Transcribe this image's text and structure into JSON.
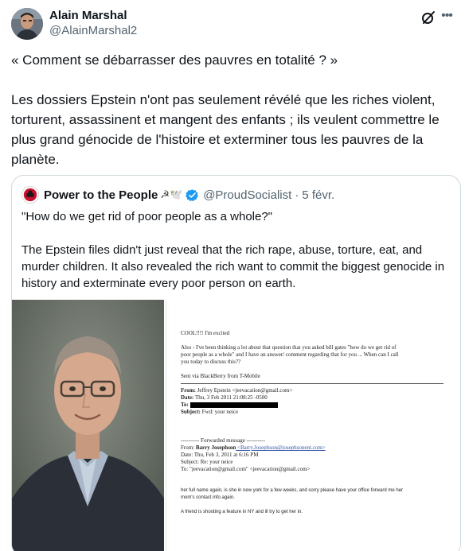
{
  "author": {
    "display_name": "Alain Marshal",
    "handle": "@AlainMarshal2"
  },
  "tweet": {
    "paragraphs": [
      "« Comment se débarrasser des pauvres en totalité ? »",
      "Les dossiers Epstein n'ont pas seulement révélé que les riches violent, torturent, assassinent et mangent des enfants ; ils veulent commettre le plus grand génocide de l'histoire et exterminer tous les pauvres de la planète."
    ]
  },
  "quote": {
    "display_name": "Power to the People",
    "name_emoji": "☭🕊️",
    "handle": "@ProudSocialist",
    "separator": "·",
    "date": "5 févr.",
    "paragraphs": [
      "\"How do we get rid of poor people as a whole?\"",
      "The Epstein files didn't just reveal that the rich rape, abuse, torture, eat, and murder children. It also revealed the rich want to commit the biggest genocide in history and exterminate every poor person on earth."
    ]
  },
  "document": {
    "line1": "COOL!!!! I'm excited",
    "line2": "Also - I've been thinking a lot about that question that you asked bill gates \"how do we get rid of",
    "line3": "poor people as a whole\" and I have an answer/ comment regarding that for you ... When can I call",
    "line4": "you today to discuss this??",
    "line5": "Sent via BlackBerry from T-Mobile",
    "from_label": "From:",
    "from_value": " Jeffrey Epstein <jeevacation@gmail.com>",
    "date_label": "Date:",
    "date_value": " Thu, 3 Feb 2011 21:08:25 -0500",
    "to_label": "To:",
    "subject_label": "Subject:",
    "subject_value": " Fwd: your neice",
    "fwd_header": "---------- Forwarded message ----------",
    "fwd_from_label": "From: ",
    "fwd_from_name": "Barry Josephson",
    "fwd_from_email": " <Barry.Josephson@josephsonent.com>",
    "fwd_date": "Date: Thu, Feb 3, 2011 at 6:16 PM",
    "fwd_subject": "Subject: Re: your neice",
    "fwd_to": "To: \"jeevacation@gmail.com\" <jeevacation@gmail.com>",
    "body1": "her full name again, is she in new york for a few weeks, and sorry please have your office forward me her",
    "body2": "mom's contact info again.",
    "body3": "A friend is shooting a feature in NY and ill try to get her in."
  },
  "colors": {
    "text": "#0f1419",
    "secondary": "#536471",
    "border": "#cfd9de",
    "verified": "#1d9bf0"
  },
  "icons": [
    "grok-icon",
    "more-icon",
    "verified-icon"
  ]
}
